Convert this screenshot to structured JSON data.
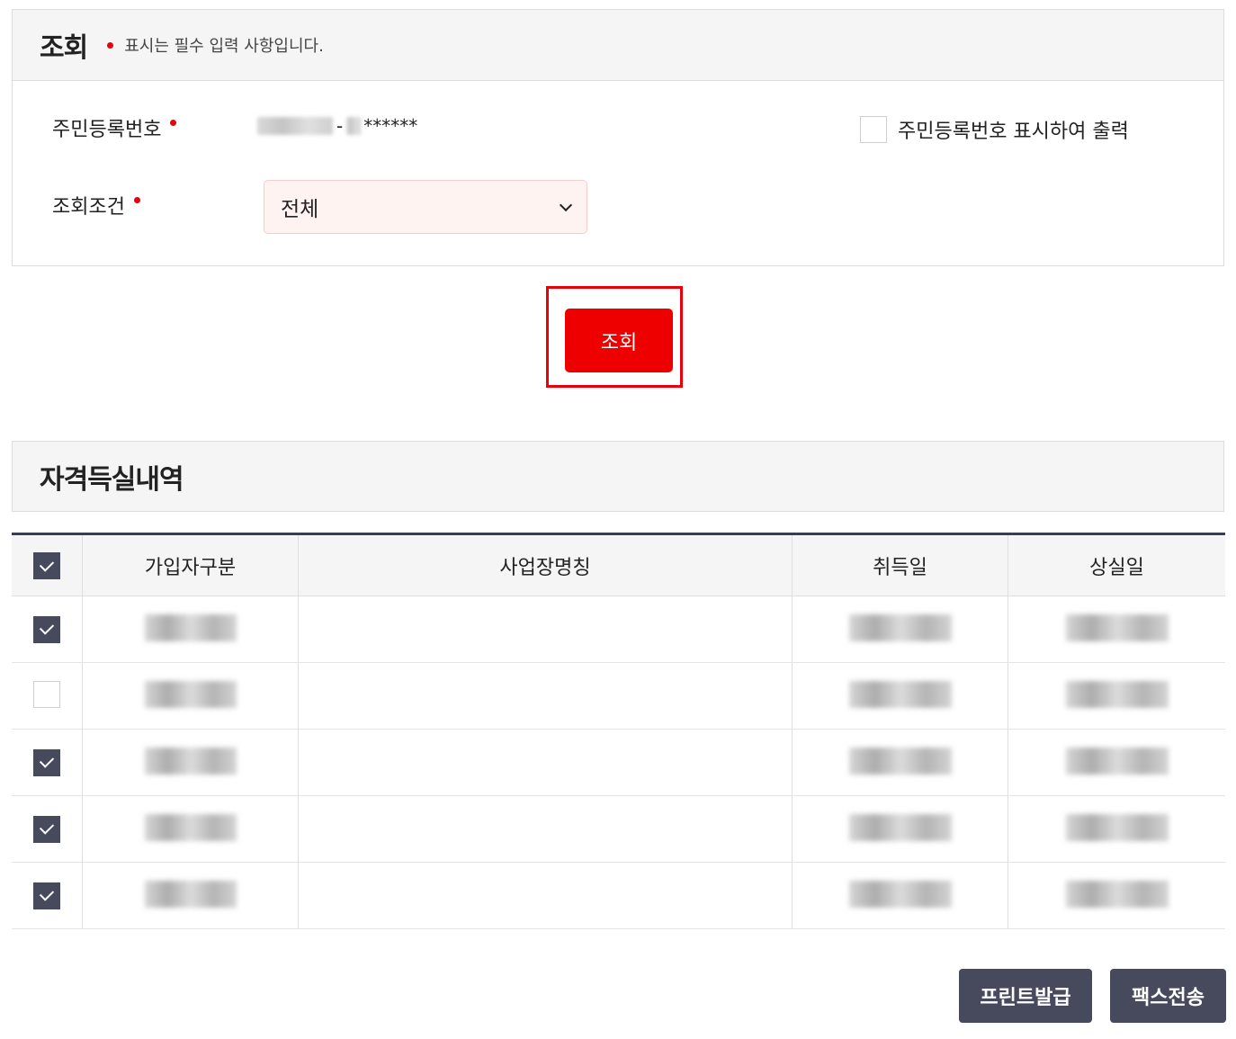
{
  "query_panel": {
    "title": "조회",
    "required_note": "표시는 필수 입력 사항입니다.",
    "resident_no_label": "주민등록번호",
    "resident_no_masked_suffix": "-",
    "resident_no_stars": "******",
    "print_option_label": "주민등록번호 표시하여 출력",
    "print_option_checked": false,
    "condition_label": "조회조건",
    "condition_selected": "전체"
  },
  "search_button_label": "조회",
  "history": {
    "title": "자격득실내역",
    "columns": [
      "가입자구분",
      "사업장명칭",
      "취득일",
      "상실일"
    ],
    "header_checked": true,
    "rows": [
      {
        "checked": true
      },
      {
        "checked": false
      },
      {
        "checked": true
      },
      {
        "checked": true
      },
      {
        "checked": true
      }
    ]
  },
  "actions": {
    "print_label": "프린트발급",
    "fax_label": "팩스전송"
  },
  "colors": {
    "accent_red": "#ee0000",
    "dark_button": "#474a5d",
    "select_bg": "#fff3f2"
  }
}
